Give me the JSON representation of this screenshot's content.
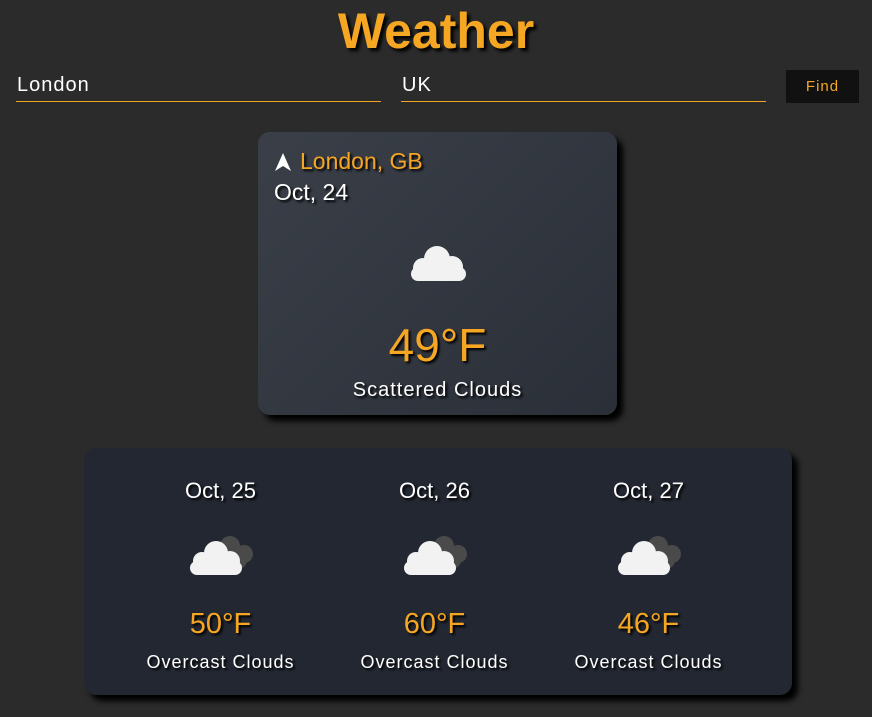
{
  "header": {
    "title": "Weather"
  },
  "search": {
    "city_value": "London",
    "country_value": "UK",
    "find_label": "Find"
  },
  "current": {
    "location": "London, GB",
    "date": "Oct, 24",
    "temp": "49°F",
    "description": "Scattered Clouds",
    "icon": "scattered-clouds-icon"
  },
  "forecast": [
    {
      "date": "Oct, 25",
      "temp": "50°F",
      "description": "Overcast Clouds",
      "icon": "overcast-clouds-icon"
    },
    {
      "date": "Oct, 26",
      "temp": "60°F",
      "description": "Overcast Clouds",
      "icon": "overcast-clouds-icon"
    },
    {
      "date": "Oct, 27",
      "temp": "46°F",
      "description": "Overcast Clouds",
      "icon": "overcast-clouds-icon"
    }
  ],
  "colors": {
    "accent": "#f5a623",
    "background": "#2b2b2b",
    "card": "#2f343d",
    "forecast_card": "#222731",
    "button": "#111111"
  }
}
